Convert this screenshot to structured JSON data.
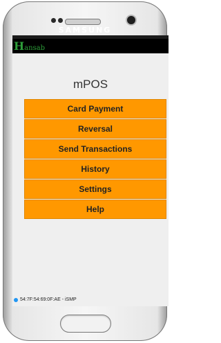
{
  "device": {
    "brand": "SAMSUNG"
  },
  "app": {
    "logo_initial": "H",
    "logo_rest": "ansab",
    "title": "mPOS"
  },
  "menu": [
    {
      "label": "Card Payment"
    },
    {
      "label": "Reversal"
    },
    {
      "label": "Send Transactions"
    },
    {
      "label": "History"
    },
    {
      "label": "Settings"
    },
    {
      "label": "Help"
    }
  ],
  "status": {
    "device_label": "54:7F:54:69:0F:AE - iSMP"
  },
  "colors": {
    "accent": "#ff9800",
    "logo": "#2e9e3a",
    "bluetooth": "#2196f3"
  },
  "icons": {
    "status_indicator": "bluetooth-dot-icon"
  }
}
